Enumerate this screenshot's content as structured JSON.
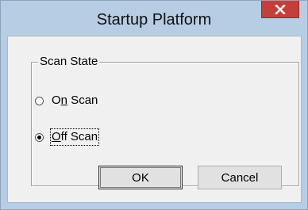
{
  "window": {
    "title": "Startup Platform",
    "close_icon": "close-icon"
  },
  "group": {
    "label": "Scan State"
  },
  "radios": {
    "on_scan": {
      "prefix": "O",
      "mnemonic": "n",
      "suffix": " Scan",
      "checked": false
    },
    "off_scan": {
      "prefix": "",
      "mnemonic": "O",
      "suffix": "ff Scan",
      "checked": true,
      "focused": true
    }
  },
  "buttons": {
    "ok_label": "OK",
    "cancel_label": "Cancel",
    "default": "ok"
  },
  "colors": {
    "titlebar": "#b7cde3",
    "close_button": "#c53f3a",
    "client_bg": "#f0f0f0"
  }
}
